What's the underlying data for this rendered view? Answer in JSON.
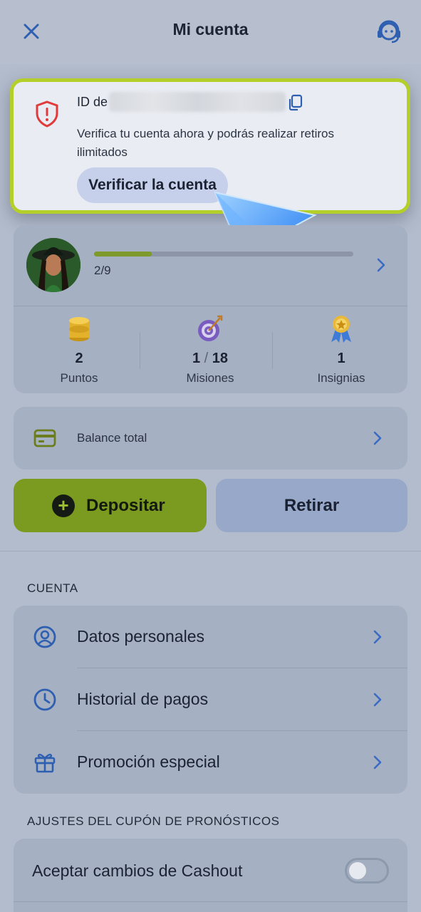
{
  "header": {
    "title": "Mi cuenta",
    "close_icon": "close-icon",
    "support_icon": "headset-support-icon"
  },
  "verify": {
    "id_label": "ID de",
    "description": "Verifica tu cuenta ahora y podrás realizar retiros ilimitados",
    "button_label": "Verificar la cuenta"
  },
  "profile": {
    "progress_text": "2/9",
    "progress_fraction": 0.222
  },
  "stats": [
    {
      "value": "2",
      "label": "Puntos",
      "icon": "coins-icon"
    },
    {
      "value_a": "1",
      "value_sep": "/",
      "value_b": "18",
      "label": "Misiones",
      "icon": "target-icon"
    },
    {
      "value": "1",
      "label": "Insignias",
      "icon": "medal-icon"
    }
  ],
  "balance": {
    "label": "Balance total"
  },
  "actions": {
    "deposit_label": "Depositar",
    "withdraw_label": "Retirar"
  },
  "account_section": {
    "title": "CUENTA",
    "items": [
      {
        "label": "Datos personales",
        "icon": "user-circle-icon"
      },
      {
        "label": "Historial de pagos",
        "icon": "clock-icon"
      },
      {
        "label": "Promoción especial",
        "icon": "gift-icon"
      }
    ]
  },
  "coupon_section": {
    "title": "AJUSTES DEL CUPÓN DE PRONÓSTICOS",
    "items": [
      {
        "label": "Aceptar cambios de Cashout",
        "toggle_on": false
      }
    ]
  },
  "colors": {
    "accent_green": "#7a9a20",
    "highlight_border": "#b5cf2a",
    "icon_blue": "#2f5fb0",
    "warning_red": "#e03a3a"
  }
}
